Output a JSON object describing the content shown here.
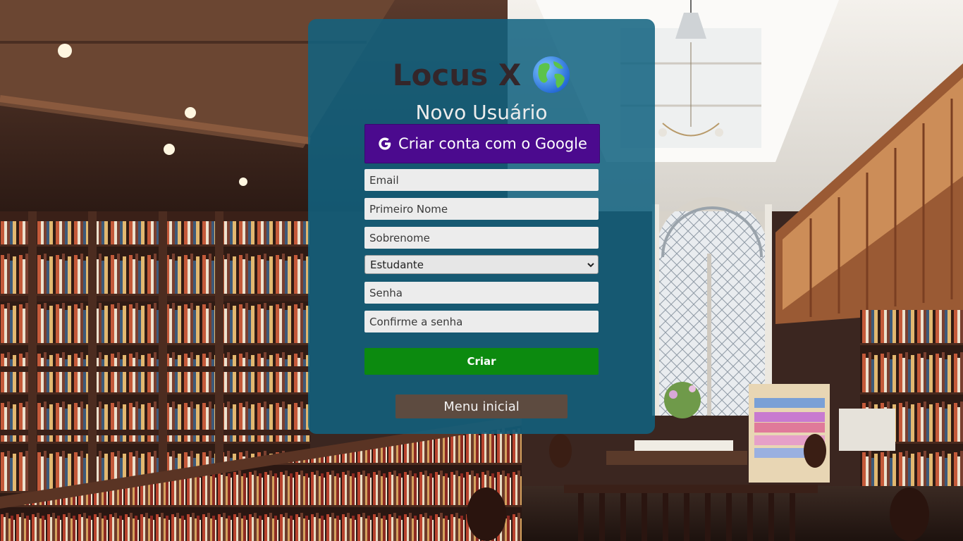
{
  "brand": {
    "name": "Locus X",
    "icon": "globe-icon"
  },
  "form": {
    "title": "Novo Usuário",
    "google_button": {
      "label": "Criar conta com o Google",
      "icon": "google-icon"
    },
    "email": {
      "placeholder": "Email",
      "value": ""
    },
    "first_name": {
      "placeholder": "Primeiro Nome",
      "value": ""
    },
    "last_name": {
      "placeholder": "Sobrenome",
      "value": ""
    },
    "role": {
      "selected": "Estudante",
      "icon": "chevron-down-icon"
    },
    "password": {
      "placeholder": "Senha",
      "value": ""
    },
    "confirm_password": {
      "placeholder": "Confirme a senha",
      "value": ""
    },
    "submit_label": "Criar",
    "menu_label": "Menu inicial"
  },
  "colors": {
    "card": "#106280",
    "google_button": "#4b0a8e",
    "submit_button": "#0c8a0f",
    "menu_button": "#5d4b40",
    "brand_text": "#34262a"
  }
}
